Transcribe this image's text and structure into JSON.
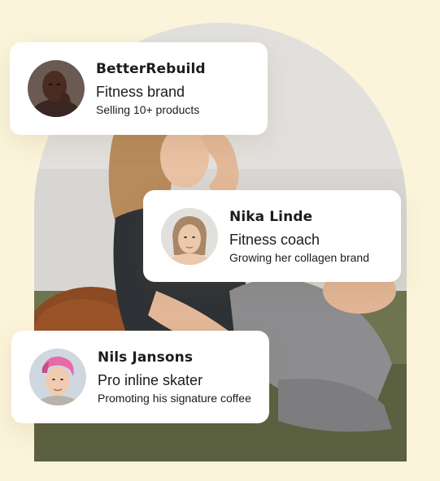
{
  "colors": {
    "background": "#fbf4da",
    "card": "#ffffff",
    "text": "#1c1c1c"
  },
  "photo": {
    "subject": "woman seated on floor with arm behind head"
  },
  "profiles": [
    {
      "name": "BetterRebuild",
      "role": "Fitness brand",
      "detail": "Selling 10+ products",
      "avatar_icon": "man-portrait-avatar"
    },
    {
      "name": "Nika Linde",
      "role": "Fitness coach",
      "detail": "Growing her collagen brand",
      "avatar_icon": "woman-portrait-avatar"
    },
    {
      "name": "Nils Jansons",
      "role": "Pro inline skater",
      "detail": "Promoting his signature coffee",
      "avatar_icon": "man-pink-hair-portrait-avatar"
    }
  ]
}
